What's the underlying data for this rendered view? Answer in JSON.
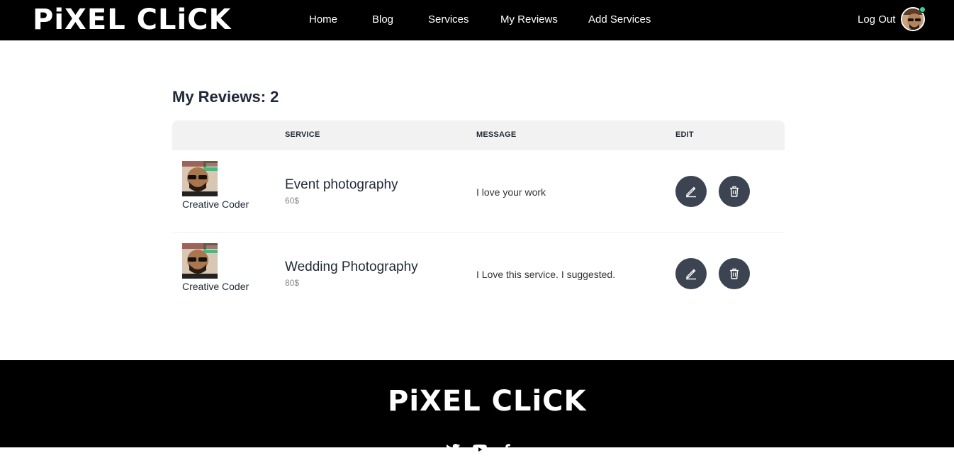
{
  "brand": {
    "logo_text": "PiXEL CLiCK"
  },
  "nav": {
    "home": "Home",
    "blog": "Blog",
    "services": "Services",
    "my_reviews": "My Reviews",
    "add_services": "Add Services",
    "logout": "Log Out"
  },
  "page": {
    "heading": "My Reviews: 2"
  },
  "table": {
    "headers": {
      "service": "SERVICE",
      "message": "MESSAGE",
      "edit": "EDIT"
    },
    "rows": [
      {
        "reviewer": "Creative Coder",
        "service": "Event photography",
        "price": "60$",
        "message": "I love your work"
      },
      {
        "reviewer": "Creative Coder",
        "service": "Wedding Photography",
        "price": "80$",
        "message": "I Love this service. I suggested."
      }
    ]
  },
  "footer": {
    "logo_text": "PiXEL CLiCK",
    "socials": [
      "twitter-icon",
      "youtube-icon",
      "facebook-icon"
    ]
  },
  "colors": {
    "nav_bg": "#000000",
    "header_row_bg": "#f2f2f2",
    "button_bg": "#3d4451",
    "online_dot": "#36d399"
  }
}
